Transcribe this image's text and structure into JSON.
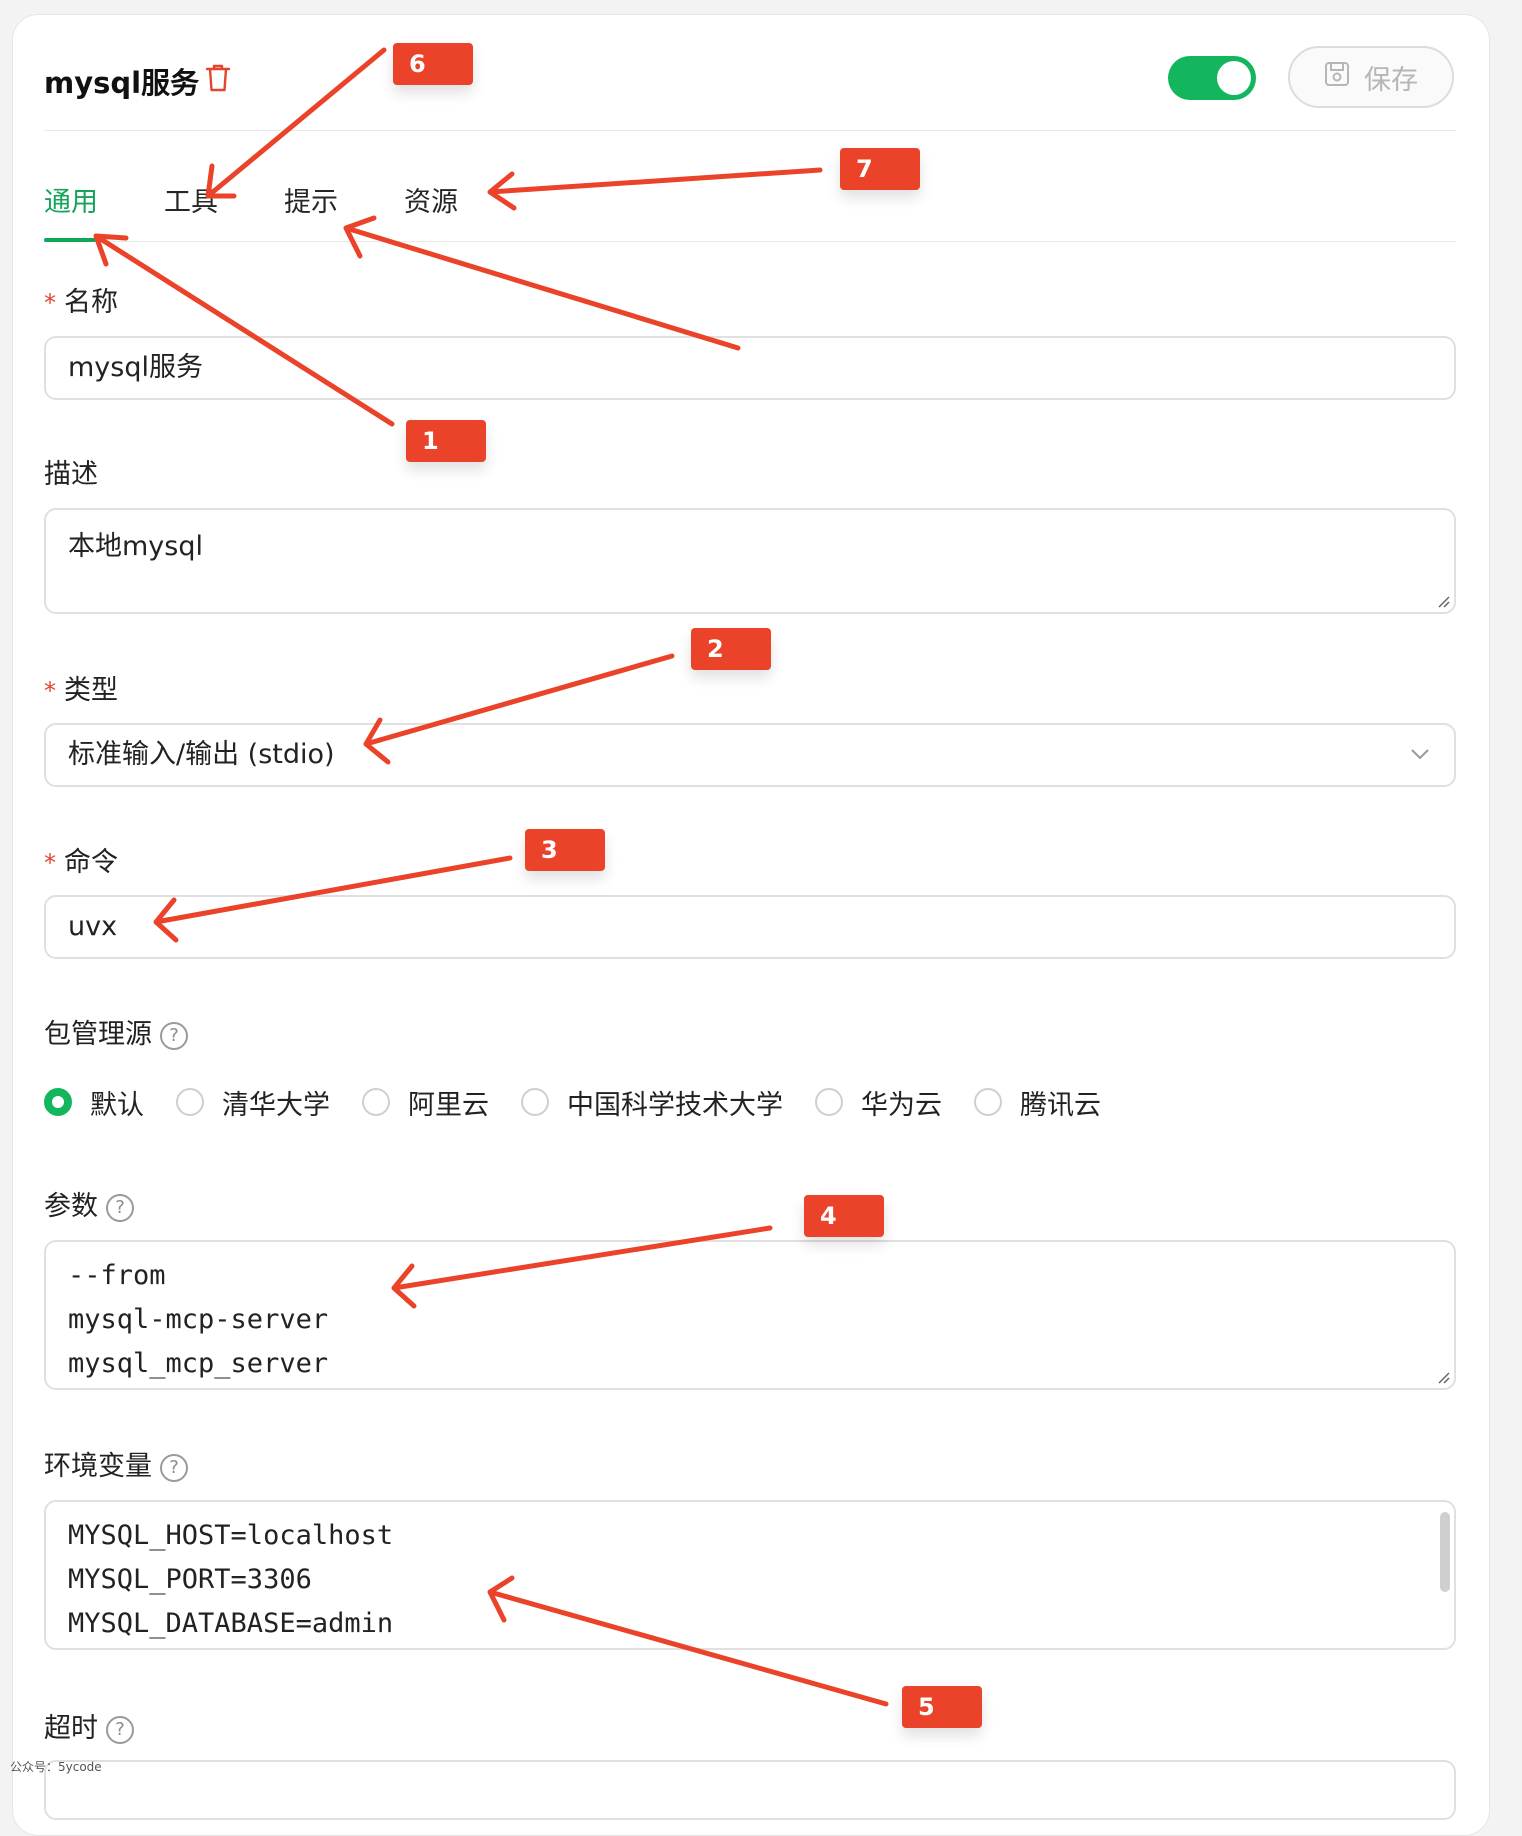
{
  "header": {
    "title": "mysql服务",
    "save_label": "保存",
    "enabled": true
  },
  "tabs": [
    {
      "label": "通用",
      "active": true
    },
    {
      "label": "工具",
      "active": false
    },
    {
      "label": "提示",
      "active": false
    },
    {
      "label": "资源",
      "active": false
    }
  ],
  "form": {
    "name": {
      "label": "名称",
      "required": true,
      "value": "mysql服务"
    },
    "description": {
      "label": "描述",
      "value": "本地mysql"
    },
    "type": {
      "label": "类型",
      "required": true,
      "value": "标准输入/输出 (stdio)"
    },
    "command": {
      "label": "命令",
      "required": true,
      "value": "uvx"
    },
    "registry": {
      "label": "包管理源",
      "options": [
        "默认",
        "清华大学",
        "阿里云",
        "中国科学技术大学",
        "华为云",
        "腾讯云"
      ],
      "selected": "默认"
    },
    "args": {
      "label": "参数",
      "lines": [
        "--from",
        "mysql-mcp-server",
        "mysql_mcp_server"
      ]
    },
    "env": {
      "label": "环境变量",
      "lines": [
        "MYSQL_HOST=localhost",
        "MYSQL_PORT=3306",
        "MYSQL_DATABASE=admin"
      ]
    },
    "timeout": {
      "label": "超时"
    }
  },
  "annotations": [
    "1",
    "2",
    "3",
    "4",
    "5",
    "6",
    "7"
  ],
  "accent_color": "#13b65d",
  "annotation_color": "#ea4329",
  "watermark": "公众号：5ycode"
}
